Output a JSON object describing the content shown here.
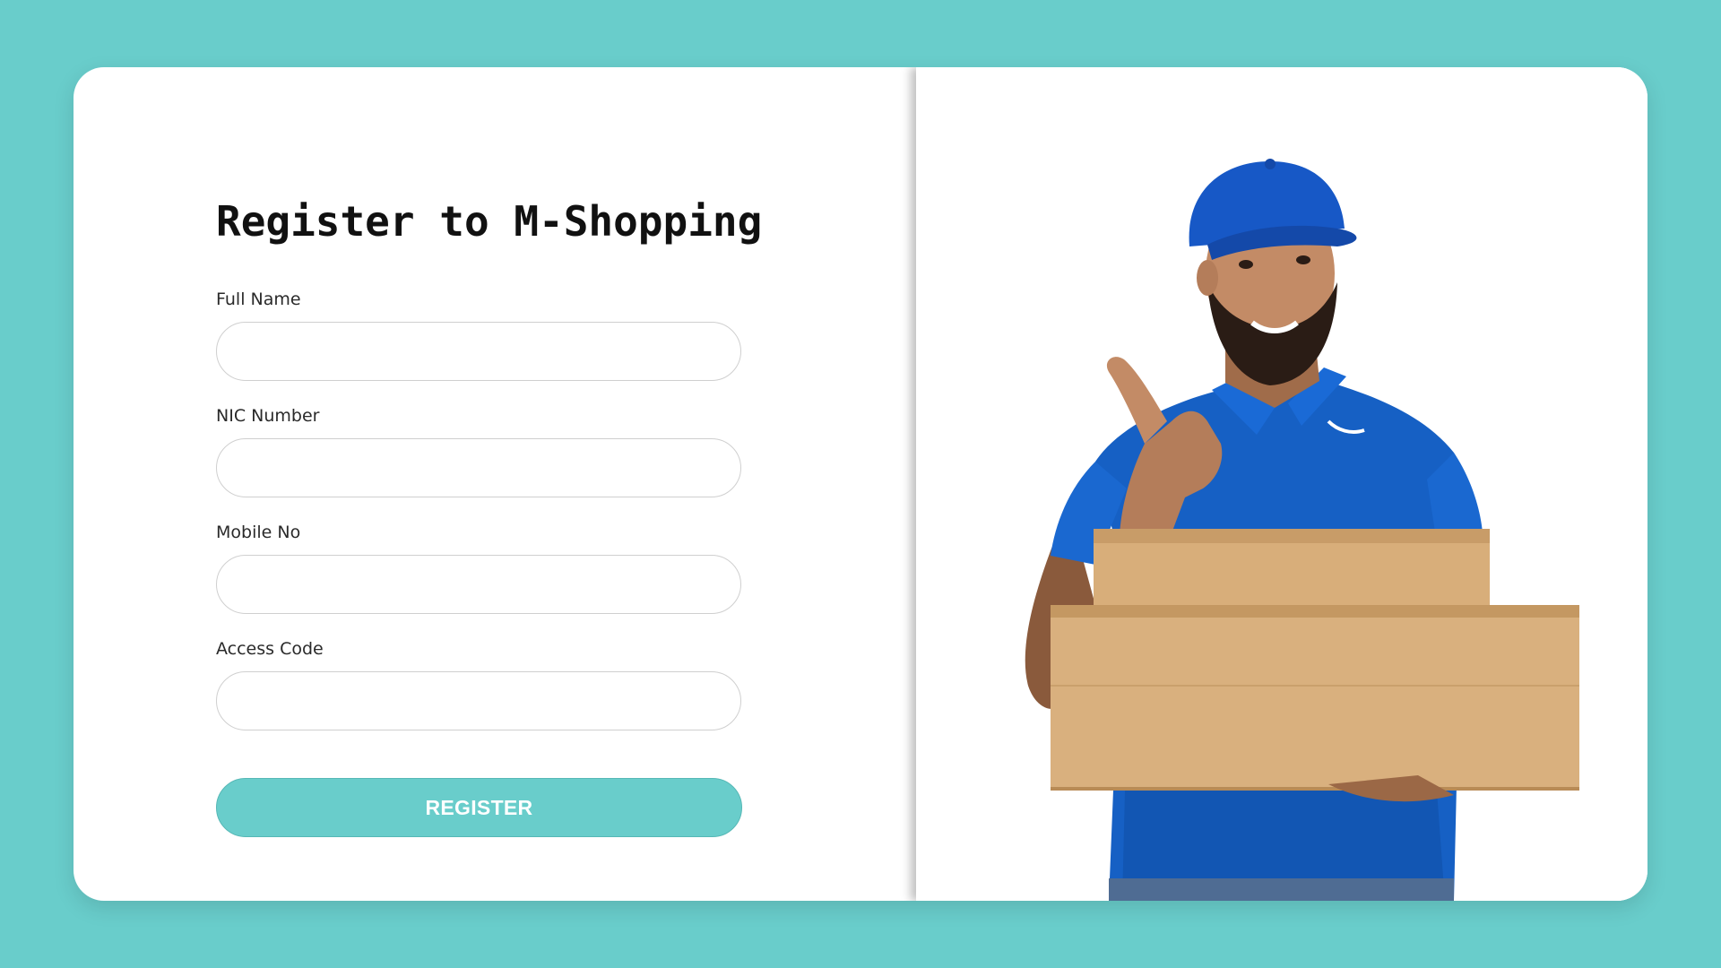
{
  "form": {
    "title": "Register to M-Shopping",
    "fields": [
      {
        "label": "Full Name",
        "value": "",
        "placeholder": ""
      },
      {
        "label": "NIC Number",
        "value": "",
        "placeholder": ""
      },
      {
        "label": "Mobile No",
        "value": "",
        "placeholder": ""
      },
      {
        "label": "Access Code",
        "value": "",
        "placeholder": ""
      }
    ],
    "submit_label": "REGISTER"
  },
  "theme": {
    "background": "#69CDCB",
    "button": "#69CDCB",
    "card": "#FFFFFF"
  },
  "image": {
    "subject": "delivery-man-holding-boxes-thumbs-up"
  }
}
